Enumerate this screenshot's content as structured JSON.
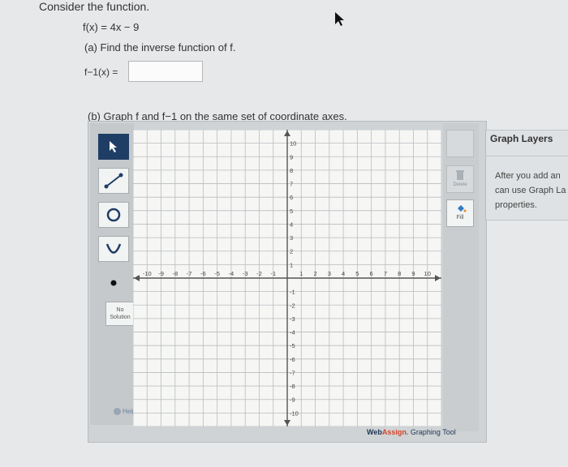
{
  "question": {
    "prompt": "Consider the function.",
    "function_def": "f(x) = 4x − 9",
    "part_a": "(a) Find the inverse function of f.",
    "inverse_label": "f−1(x) =",
    "answer_value": "",
    "part_b": "(b) Graph f and f−1 on the same set of coordinate axes."
  },
  "toolbar": {
    "tools": [
      "pointer-icon",
      "line-tool-icon",
      "circle-tool-icon",
      "parabola-tool-icon",
      "point-tool-icon"
    ],
    "no_solution_label": "No Solution",
    "help_label": "Help",
    "fill_label": "Fill",
    "delete_label": "Delete"
  },
  "graph": {
    "x_ticks": [
      "-10",
      "-9",
      "-8",
      "-7",
      "-6",
      "-5",
      "-4",
      "-3",
      "-2",
      "-1",
      "1",
      "2",
      "3",
      "4",
      "5",
      "6",
      "7",
      "8",
      "9",
      "10"
    ],
    "y_ticks": [
      "10",
      "9",
      "8",
      "7",
      "6",
      "5",
      "4",
      "3",
      "2",
      "1",
      "-1",
      "-2",
      "-3",
      "-4",
      "-5",
      "-6",
      "-7",
      "-8",
      "-9",
      "-10"
    ],
    "xlim": [
      -11,
      11
    ],
    "ylim": [
      -11,
      11
    ]
  },
  "branding": {
    "web": "Web",
    "assign": "Assign.",
    "tool": " Graphing Tool"
  },
  "layers": {
    "title": "Graph Layers",
    "body": "After you add an\ncan use Graph La\nproperties."
  },
  "colors": {
    "pointer_active": "#1f3e66",
    "accent_red": "#d0462b",
    "grid": "#b8bcc0"
  }
}
